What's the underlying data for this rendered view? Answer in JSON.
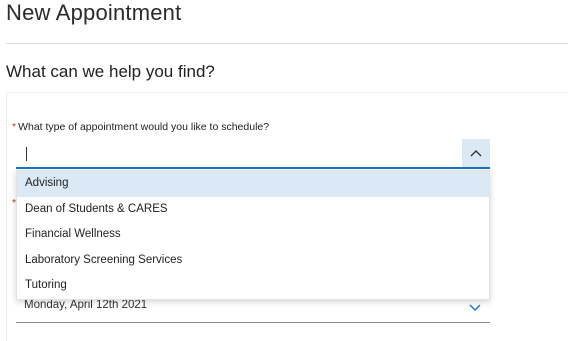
{
  "page": {
    "title": "New Appointment",
    "section_title": "What can we help you find?"
  },
  "appointment_type": {
    "required_marker": "*",
    "label": "What type of appointment would you like to schedule?",
    "value": "",
    "toggle_icon": "chevron-up-icon",
    "options": [
      "Advising",
      "Dean of Students & CARES",
      "Financial Wellness",
      "Laboratory Screening Services",
      "Tutoring"
    ],
    "highlighted_option": "Advising"
  },
  "second_field": {
    "required_marker": "*"
  },
  "date": {
    "value": "Monday, April 12th 2021",
    "chevron_icon": "chevron-down-icon"
  },
  "colors": {
    "accent": "#1a73c9",
    "highlight": "#dbe8f6",
    "required": "#c0392b"
  }
}
